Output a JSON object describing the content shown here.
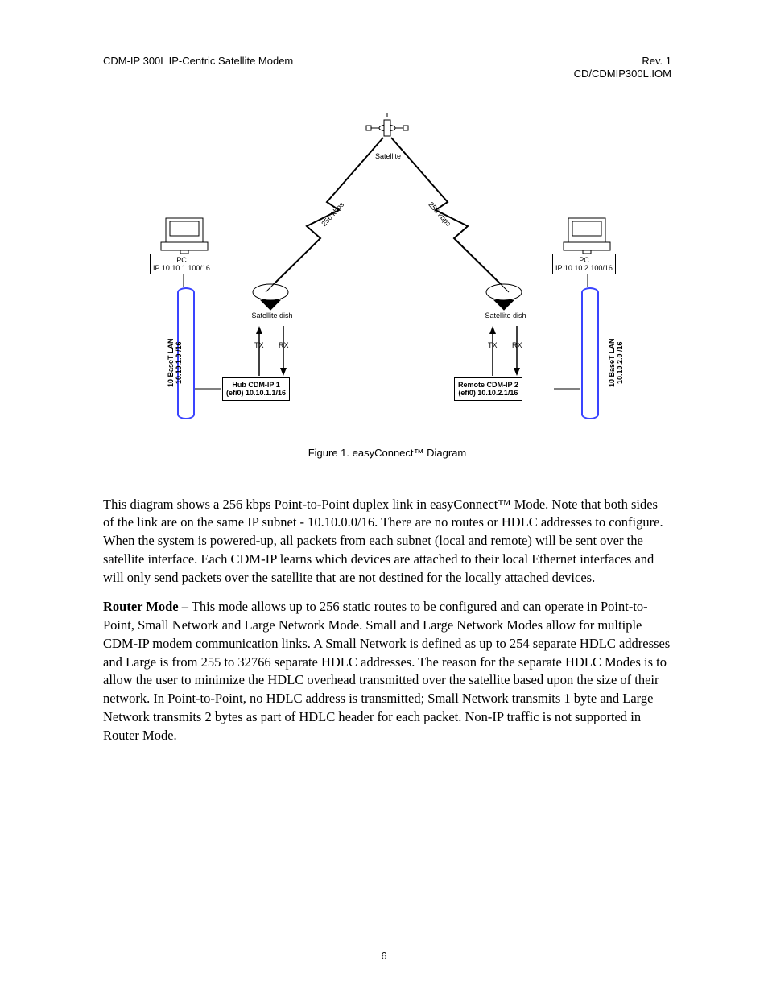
{
  "header": {
    "left": "CDM-IP 300L IP-Centric Satellite Modem",
    "right1": "Rev. 1",
    "right2": "CD/CDMIP300L.IOM"
  },
  "diagram": {
    "satellite": "Satellite",
    "link_left": "256 kbps",
    "link_right": "256 kbps",
    "left": {
      "pc_line1": "PC",
      "pc_line2": "IP 10.10.1.100/16",
      "lan_line1": "10 BaseT LAN",
      "lan_line2": "10.10.1.0 /16",
      "dish": "Satellite dish",
      "tx": "TX",
      "rx": "RX",
      "dev_line1": "Hub CDM-IP 1",
      "dev_line2": "(efi0) 10.10.1.1/16"
    },
    "right": {
      "pc_line1": "PC",
      "pc_line2": "IP 10.10.2.100/16",
      "lan_line1": "10 BaseT LAN",
      "lan_line2": "10.10.2.0 /16",
      "dish": "Satellite dish",
      "tx": "TX",
      "rx": "RX",
      "dev_line1": "Remote CDM-IP 2",
      "dev_line2": "(efi0) 10.10.2.1/16"
    }
  },
  "caption": {
    "prefix": "Figure 1.  easyConnect",
    "suffix": " Diagram"
  },
  "para1": {
    "t1": "This diagram shows a 256 kbps Point-to-Point duplex link in easyConnect",
    "t2": " Mode. Note that both sides of the link are on the same IP subnet - 10.10.0.0/16. There are no routes or HDLC addresses to configure. When the system is powered-up, all packets from each subnet (local and remote) will be sent over the satellite interface. Each CDM-IP learns which devices are attached to their local Ethernet interfaces and will only send packets over the satellite that are not destined for the locally attached devices."
  },
  "para2": {
    "bold": "Router Mode",
    "rest": " – This mode allows up to 256 static routes to be configured and can operate in Point-to-Point, Small Network and Large Network Mode. Small and Large Network Modes allow for multiple CDM-IP modem communication links. A Small Network is defined as up to 254 separate HDLC addresses and Large is from 255 to 32766 separate HDLC addresses. The reason for the separate HDLC Modes is to allow the user to minimize the HDLC overhead transmitted over the satellite based upon the size of their network. In Point-to-Point, no HDLC address is transmitted; Small Network transmits 1 byte and Large Network transmits 2 bytes as part of HDLC header for each packet. Non-IP traffic is not supported in Router Mode."
  },
  "page_number": "6"
}
